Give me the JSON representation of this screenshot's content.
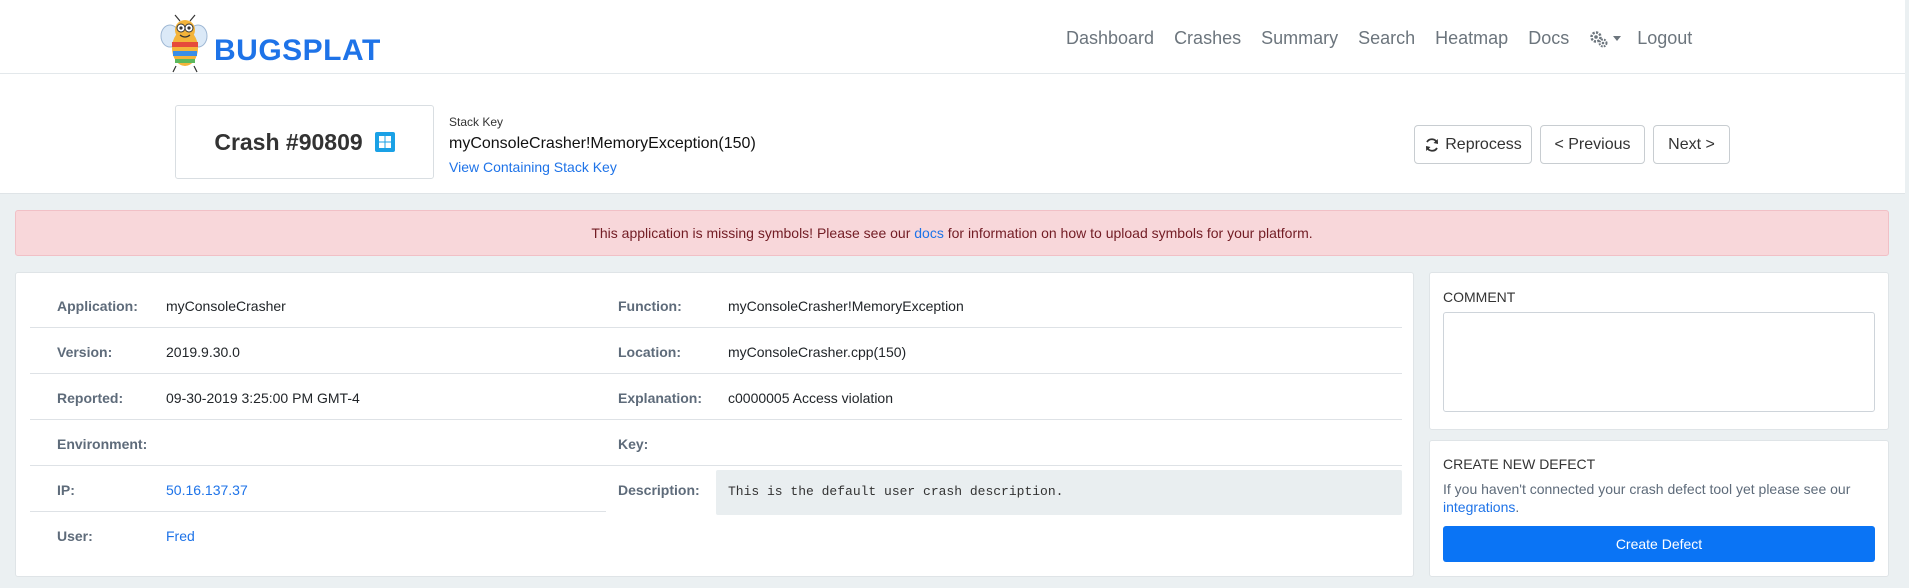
{
  "brand": {
    "name": "BUGSPLAT"
  },
  "nav": {
    "items": [
      "Dashboard",
      "Crashes",
      "Summary",
      "Search",
      "Heatmap",
      "Docs"
    ],
    "logout": "Logout"
  },
  "crash": {
    "title": "Crash #90809",
    "platform_icon": "windows-icon",
    "stack_key_label": "Stack Key",
    "stack_key_value": "myConsoleCrasher!MemoryException(150)",
    "stack_key_link": "View Containing Stack Key"
  },
  "actions": {
    "reprocess": "Reprocess",
    "previous": "< Previous",
    "next": "Next >"
  },
  "alert": {
    "before": "This application is missing symbols! Please see our ",
    "link": "docs",
    "after": " for information on how to upload symbols for your platform."
  },
  "details": {
    "left": [
      {
        "label": "Application:",
        "value": "myConsoleCrasher"
      },
      {
        "label": "Version:",
        "value": "2019.9.30.0"
      },
      {
        "label": "Reported:",
        "value": "09-30-2019 3:25:00 PM GMT-4"
      },
      {
        "label": "Environment:",
        "value": ""
      },
      {
        "label": "IP:",
        "value": "50.16.137.37"
      },
      {
        "label": "User:",
        "value": "Fred"
      }
    ],
    "right": [
      {
        "label": "Function:",
        "value": "myConsoleCrasher!MemoryException"
      },
      {
        "label": "Location:",
        "value": "myConsoleCrasher.cpp(150)"
      },
      {
        "label": "Explanation:",
        "value": "c0000005 Access violation"
      },
      {
        "label": "Key:",
        "value": ""
      },
      {
        "label": "Description:",
        "value": "This is the default user crash description."
      }
    ]
  },
  "comment": {
    "title": "COMMENT",
    "value": ""
  },
  "defect": {
    "title": "CREATE NEW DEFECT",
    "text": "If you haven't connected your crash defect tool yet please see our",
    "link": "integrations",
    "period": ".",
    "button": "Create Defect"
  },
  "colors": {
    "accent": "#1e73e8",
    "alert_bg": "#f8d7da",
    "button_primary": "#0a74f5"
  }
}
